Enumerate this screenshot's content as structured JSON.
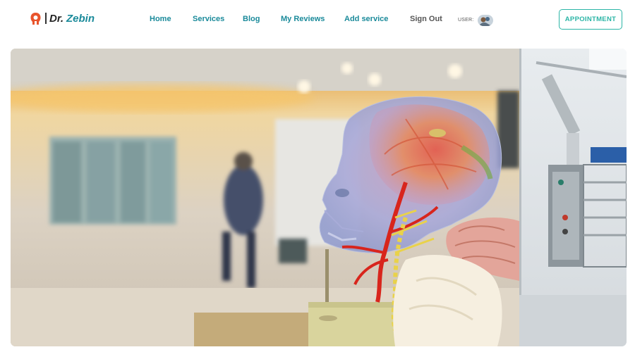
{
  "brand": {
    "prefix": "Dr.",
    "name": "Zebin",
    "icon": "medical-logo-icon",
    "accent": "#1a8a9a"
  },
  "nav": {
    "items": [
      {
        "label": "Home"
      },
      {
        "label": "Services"
      },
      {
        "label": "Blog"
      },
      {
        "label": "My Reviews"
      },
      {
        "label": "Add service"
      },
      {
        "label": "Sign Out"
      }
    ],
    "user_label": "USER:",
    "avatar_icon": "user-avatar"
  },
  "appointment_button": {
    "label": "APPOINTMENT",
    "color": "#2bb5a6"
  },
  "hero": {
    "image": "anatomical-skull-model-photo"
  }
}
